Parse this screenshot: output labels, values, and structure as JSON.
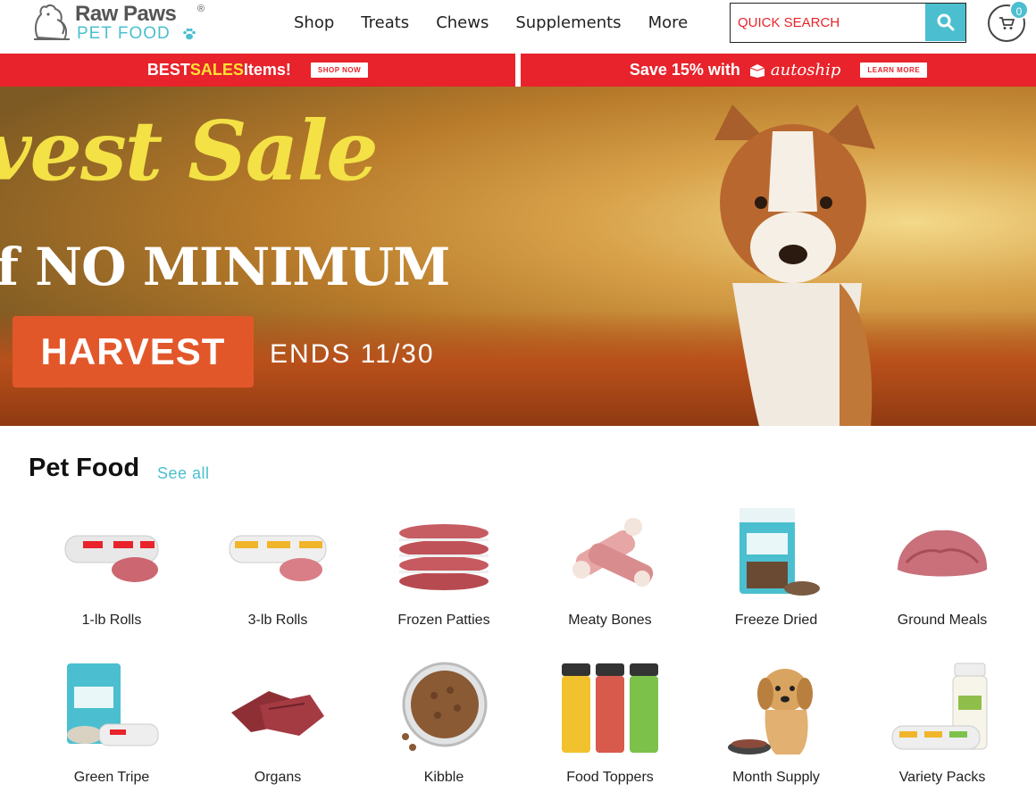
{
  "header": {
    "brand_line1": "Raw Paws",
    "brand_registered": "®",
    "brand_line2": "PET FOOD",
    "nav": [
      "Shop",
      "Treats",
      "Chews",
      "Supplements",
      "More"
    ],
    "search_placeholder": "QUICK SEARCH",
    "cart_count": "0"
  },
  "promo": {
    "left_text_pre": "BEST ",
    "left_text_highlight": "SALES",
    "left_text_post": " Items!",
    "left_cta": "SHOP NOW",
    "right_text": "Save 15% with",
    "right_brand": "autoship",
    "right_cta": "LEARN MORE"
  },
  "hero": {
    "title": "vest Sale",
    "subtitle": "f NO MINIMUM",
    "tag": "HARVEST",
    "ends": "ENDS 11/30"
  },
  "pet_food": {
    "title": "Pet Food",
    "see_all": "See all",
    "items": [
      {
        "label": "1-lb Rolls",
        "icon": "beef-roll-icon"
      },
      {
        "label": "3-lb Rolls",
        "icon": "chicken-roll-icon"
      },
      {
        "label": "Frozen Patties",
        "icon": "patties-icon"
      },
      {
        "label": "Meaty Bones",
        "icon": "bones-icon"
      },
      {
        "label": "Freeze Dried",
        "icon": "freeze-dried-bag-icon"
      },
      {
        "label": "Ground Meals",
        "icon": "ground-meat-icon"
      },
      {
        "label": "Green Tripe",
        "icon": "green-tripe-bag-icon"
      },
      {
        "label": "Organs",
        "icon": "organs-icon"
      },
      {
        "label": "Kibble",
        "icon": "kibble-bowl-icon"
      },
      {
        "label": "Food Toppers",
        "icon": "toppers-jars-icon"
      },
      {
        "label": "Month Supply",
        "icon": "puppy-icon"
      },
      {
        "label": "Variety Packs",
        "icon": "variety-pack-icon"
      }
    ]
  },
  "colors": {
    "accent": "#4bbfcf",
    "promo_red": "#e8232b",
    "promo_yellow": "#fde135",
    "hero_tag": "#e2572a"
  }
}
